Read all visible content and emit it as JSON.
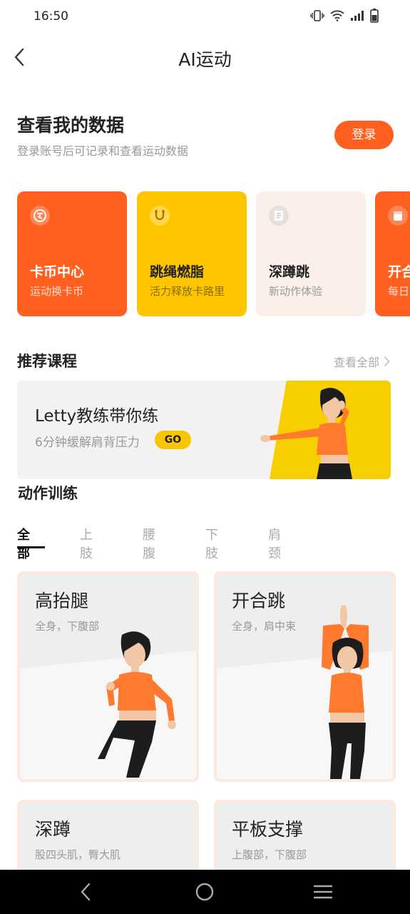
{
  "status": {
    "time": "16:50"
  },
  "header": {
    "title": "AI运动"
  },
  "login_section": {
    "title": "查看我的数据",
    "subtitle": "登录账号后可记录和查看运动数据",
    "login_label": "登录"
  },
  "features": [
    {
      "title": "卡币中心",
      "subtitle": "运动换卡币",
      "icon": "coin-icon",
      "bg": "#ff5f1f"
    },
    {
      "title": "跳绳燃脂",
      "subtitle": "活力释放卡路里",
      "icon": "jump-rope-icon",
      "bg": "#ffc600"
    },
    {
      "title": "深蹲跳",
      "subtitle": "新动作体验",
      "icon": "note-icon",
      "bg": "#fbefea"
    },
    {
      "title": "开合",
      "subtitle": "每日",
      "icon": "calendar-icon",
      "bg": "#ff5f1f"
    }
  ],
  "recommended": {
    "title": "推荐课程",
    "view_all": "查看全部",
    "course_title": "Letty教练带你练",
    "course_subtitle": "6分钟缓解肩背压力",
    "go_label": "GO"
  },
  "action_training": {
    "title": "动作训练",
    "tabs": [
      {
        "label": "全部",
        "active": true
      },
      {
        "label": "上肢",
        "active": false
      },
      {
        "label": "腰腹",
        "active": false
      },
      {
        "label": "下肢",
        "active": false
      },
      {
        "label": "肩颈",
        "active": false
      }
    ],
    "exercises": [
      {
        "title": "高抬腿",
        "subtitle": "全身，下腹部"
      },
      {
        "title": "开合跳",
        "subtitle": "全身，肩中束"
      },
      {
        "title": "深蹲",
        "subtitle": "股四头肌，臀大肌"
      },
      {
        "title": "平板支撑",
        "subtitle": "上腹部，下腹部"
      }
    ]
  },
  "colors": {
    "accent": "#ff5f1f",
    "yellow": "#ffc600",
    "card_border": "#fde9df"
  }
}
